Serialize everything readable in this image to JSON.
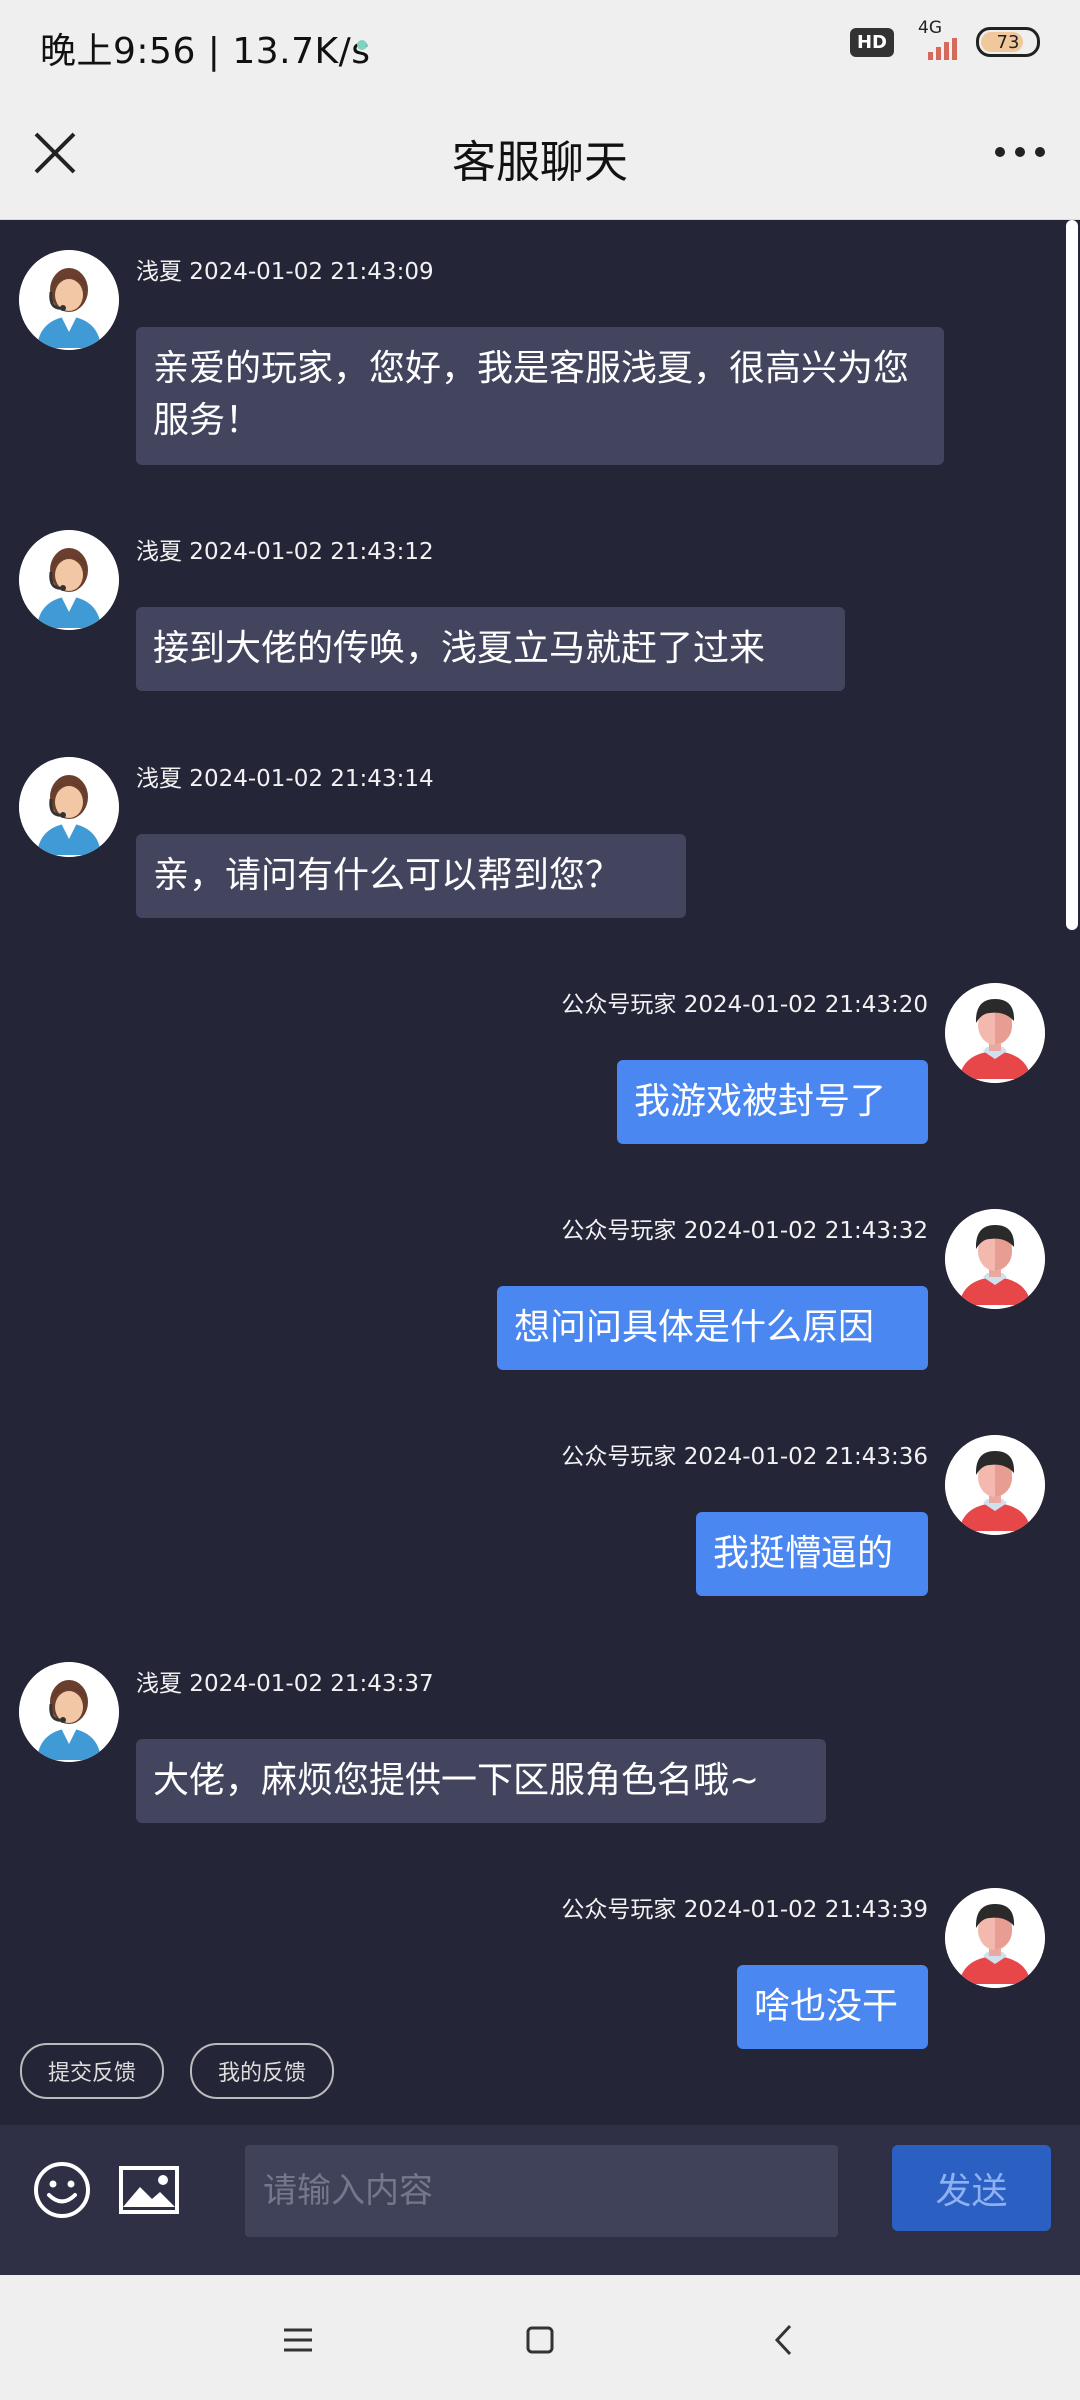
{
  "status_bar": {
    "time_speed": "晚上9:56 | 13.7K/s",
    "hd": "HD",
    "network": "4G",
    "battery": "73"
  },
  "header": {
    "title": "客服聊天",
    "close_icon": "close-icon",
    "more_icon": "more-dots-icon"
  },
  "messages": [
    {
      "side": "agent",
      "sender": "浅夏",
      "time": "2024-01-02 21:43:09",
      "text": "亲爱的玩家，您好，我是客服浅夏，很高兴为您服务！"
    },
    {
      "side": "agent",
      "sender": "浅夏",
      "time": "2024-01-02 21:43:12",
      "text": "接到大佬的传唤，浅夏立马就赶了过来"
    },
    {
      "side": "agent",
      "sender": "浅夏",
      "time": "2024-01-02 21:43:14",
      "text": "亲，请问有什么可以帮到您？"
    },
    {
      "side": "user",
      "sender": "公众号玩家",
      "time": "2024-01-02 21:43:20",
      "text": "我游戏被封号了"
    },
    {
      "side": "user",
      "sender": "公众号玩家",
      "time": "2024-01-02 21:43:32",
      "text": "想问问具体是什么原因"
    },
    {
      "side": "user",
      "sender": "公众号玩家",
      "time": "2024-01-02 21:43:36",
      "text": "我挺懵逼的"
    },
    {
      "side": "agent",
      "sender": "浅夏",
      "time": "2024-01-02 21:43:37",
      "text": "大佬，麻烦您提供一下区服角色名哦~"
    },
    {
      "side": "user",
      "sender": "公众号玩家",
      "time": "2024-01-02 21:43:39",
      "text": "啥也没干"
    }
  ],
  "quick_actions": [
    "提交反馈",
    "我的反馈"
  ],
  "input": {
    "placeholder": "请输入内容",
    "send_label": "发送"
  },
  "colors": {
    "chat_bg": "#242537",
    "agent_bubble": "#43455f",
    "user_bubble": "#4b87f1",
    "send_button": "#2b5fc2"
  }
}
